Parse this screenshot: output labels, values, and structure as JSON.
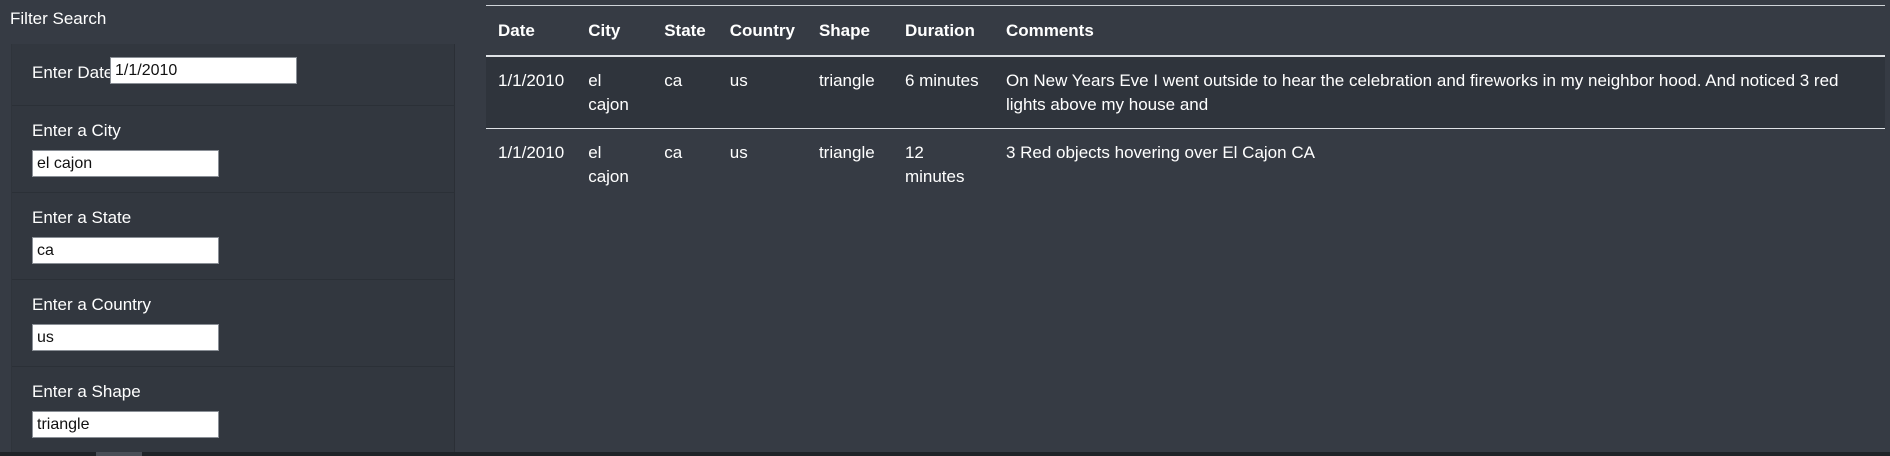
{
  "filter": {
    "title": "Filter Search",
    "date": {
      "label": "Enter Date",
      "value": "1/1/2010"
    },
    "city": {
      "label": "Enter a City",
      "value": "el cajon"
    },
    "state": {
      "label": "Enter a State",
      "value": "ca"
    },
    "country": {
      "label": "Enter a Country",
      "value": "us"
    },
    "shape": {
      "label": "Enter a Shape",
      "value": "triangle"
    }
  },
  "table": {
    "headers": [
      "Date",
      "City",
      "State",
      "Country",
      "Shape",
      "Duration",
      "Comments"
    ],
    "rows": [
      {
        "date": "1/1/2010",
        "city": "el cajon",
        "state": "ca",
        "country": "us",
        "shape": "triangle",
        "duration": "6 minutes",
        "comments": "On New Years Eve I went outside to hear the celebration and fireworks in my neighbor hood. And noticed 3 red lights above my house and"
      },
      {
        "date": "1/1/2010",
        "city": "el cajon",
        "state": "ca",
        "country": "us",
        "shape": "triangle",
        "duration": "12 minutes",
        "comments": "3 Red objects hovering over El Cajon CA"
      }
    ]
  }
}
